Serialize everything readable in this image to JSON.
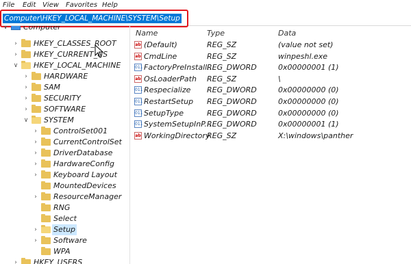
{
  "menu": [
    "File",
    "Edit",
    "View",
    "Favorites",
    "Help"
  ],
  "address": "Computer\\HKEY_LOCAL_MACHINE\\SYSTEM\\Setup",
  "tree": {
    "root": "Computer",
    "hives": [
      "HKEY_CLASSES_ROOT",
      "HKEY_CURRENT_USER",
      "HKEY_LOCAL_MACHINE"
    ],
    "hklm_children": [
      "HARDWARE",
      "SAM",
      "SECURITY",
      "SOFTWARE",
      "SYSTEM"
    ],
    "system_children": [
      "ControlSet001",
      "CurrentControlSet",
      "DriverDatabase",
      "HardwareConfig",
      "Keyboard Layout",
      "MountedDevices",
      "ResourceManager",
      "RNG",
      "Select",
      "Setup",
      "Software",
      "WPA"
    ],
    "last_hive": "HKEY_USERS",
    "hives_visible": [
      "HKEY_CLASSES_ROOT",
      "HKEY_CURRENT_US"
    ]
  },
  "columns": {
    "name": "Name",
    "type": "Type",
    "data": "Data"
  },
  "values": [
    {
      "icon": "ab",
      "name": "(Default)",
      "type": "REG_SZ",
      "data": "(value not set)"
    },
    {
      "icon": "ab",
      "name": "CmdLine",
      "type": "REG_SZ",
      "data": "winpeshl.exe"
    },
    {
      "icon": "bin",
      "name": "FactoryPreInstall...",
      "type": "REG_DWORD",
      "data": "0x00000001 (1)"
    },
    {
      "icon": "ab",
      "name": "OsLoaderPath",
      "type": "REG_SZ",
      "data": "\\"
    },
    {
      "icon": "bin",
      "name": "Respecialize",
      "type": "REG_DWORD",
      "data": "0x00000000 (0)"
    },
    {
      "icon": "bin",
      "name": "RestartSetup",
      "type": "REG_DWORD",
      "data": "0x00000000 (0)"
    },
    {
      "icon": "bin",
      "name": "SetupType",
      "type": "REG_DWORD",
      "data": "0x00000000 (0)"
    },
    {
      "icon": "bin",
      "name": "SystemSetupInP...",
      "type": "REG_DWORD",
      "data": "0x00000001 (1)"
    },
    {
      "icon": "ab",
      "name": "WorkingDirectory",
      "type": "REG_SZ",
      "data": "X:\\windows\\panther"
    }
  ],
  "icon_glyphs": {
    "ab": "ab",
    "bin": "011"
  },
  "colors": {
    "selection": "#0078d7",
    "highlight": "#cce8ff",
    "annotation": "#e2161d",
    "folder": "#e9c25a"
  }
}
